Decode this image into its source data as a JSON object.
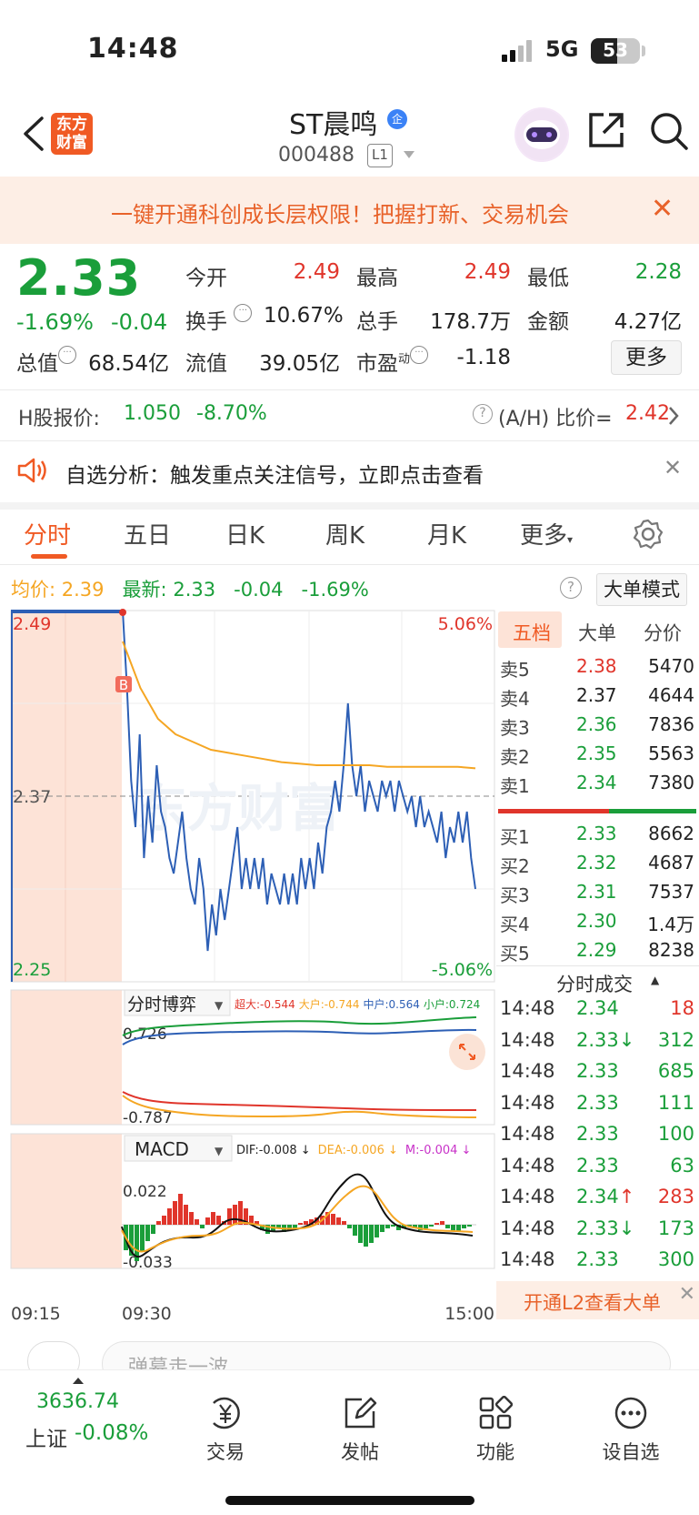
{
  "status": {
    "time": "14:48",
    "network": "5G",
    "battery": "53",
    "battery_level": 0.53
  },
  "nav": {
    "logo": "东方\n财富",
    "logo_line1": "东方",
    "logo_line2": "财富",
    "stock_name": "ST晨鸣",
    "ent_badge": "企",
    "stock_code": "000488",
    "level": "L1"
  },
  "banner": {
    "text": "一键开通科创成长层权限！把握打新、交易机会"
  },
  "quote": {
    "price": "2.33",
    "change_pct": "-1.69%",
    "change_abs": "-0.04",
    "open_label": "今开",
    "open": "2.49",
    "high_label": "最高",
    "high": "2.49",
    "low_label": "最低",
    "low": "2.28",
    "turnover_label": "换手",
    "turnover": "10.67%",
    "volume_label": "总手",
    "volume": "178.7万",
    "amount_label": "金额",
    "amount": "4.27亿",
    "mktcap_label": "总值",
    "mktcap": "68.54亿",
    "float_label": "流值",
    "float": "39.05亿",
    "pe_label": "市盈",
    "pe_sup": "动",
    "pe": "-1.18",
    "more": "更多"
  },
  "hshare": {
    "label": "H股报价:",
    "price": "1.050",
    "change": "-8.70%",
    "ratio_label": "(A/H) 比价=",
    "ratio": "2.42"
  },
  "alert": {
    "text": "自选分析：触发重点关注信号，立即点击查看"
  },
  "tabs": [
    "分时",
    "五日",
    "日K",
    "周K",
    "月K",
    "更多"
  ],
  "legend": {
    "avg_label": "均价:",
    "avg": "2.39",
    "latest_label": "最新:",
    "latest": "2.33",
    "latest_chg": "-0.04",
    "latest_pct": "-1.69%",
    "big_mode": "大单模式"
  },
  "chart_data": {
    "type": "line",
    "y_max_label": "2.49",
    "y_mid_label": "2.37",
    "y_min_label": "2.25",
    "pct_max_label": "5.06%",
    "pct_min_label": "-5.06%",
    "time_labels": [
      "09:15",
      "09:30",
      "15:00"
    ],
    "ylim": [
      2.25,
      2.49
    ],
    "prev_close": 2.37,
    "buy_marker": "B",
    "watermark": "东方财富",
    "series": [
      {
        "name": "最新",
        "color": "#2d5fb5",
        "values": [
          2.49,
          2.44,
          2.38,
          2.35,
          2.41,
          2.33,
          2.37,
          2.34,
          2.39,
          2.36,
          2.35,
          2.33,
          2.32,
          2.34,
          2.36,
          2.33,
          2.31,
          2.3,
          2.33,
          2.31,
          2.27,
          2.3,
          2.28,
          2.31,
          2.29,
          2.31,
          2.33,
          2.35,
          2.31,
          2.33,
          2.31,
          2.33,
          2.31,
          2.33,
          2.3,
          2.32,
          2.31,
          2.3,
          2.32,
          2.3,
          2.32,
          2.3,
          2.33,
          2.31,
          2.33,
          2.31,
          2.34,
          2.32,
          2.35,
          2.36,
          2.38,
          2.36,
          2.39,
          2.43,
          2.39,
          2.37,
          2.39,
          2.36,
          2.38,
          2.37,
          2.36,
          2.38,
          2.37,
          2.38,
          2.36,
          2.38,
          2.37,
          2.36,
          2.37,
          2.35,
          2.37,
          2.35,
          2.36,
          2.35,
          2.34,
          2.36,
          2.33,
          2.35,
          2.34,
          2.36,
          2.34,
          2.36,
          2.33,
          2.31
        ]
      },
      {
        "name": "均价",
        "color": "#f5a623",
        "values": [
          2.47,
          2.44,
          2.42,
          2.41,
          2.405,
          2.4,
          2.398,
          2.396,
          2.394,
          2.392,
          2.391,
          2.39,
          2.39,
          2.39,
          2.39,
          2.389,
          2.389,
          2.389,
          2.389,
          2.389,
          2.388
        ]
      }
    ],
    "game_panel": {
      "title": "分时博弈",
      "super_label": "超大:",
      "super": "-0.544",
      "big_label": "大户:",
      "big": "-0.744",
      "mid_label": "中户:",
      "mid": "0.564",
      "small_label": "小户:",
      "small": "0.724",
      "top_label": "0.726",
      "bottom_label": "-0.787"
    },
    "macd_panel": {
      "title": "MACD",
      "dif_label": "DIF:",
      "dif": "-0.008",
      "dea_label": "DEA:",
      "dea": "-0.006",
      "m_label": "M:",
      "m": "-0.004",
      "top_label": "0.022",
      "bottom_label": "-0.033"
    }
  },
  "orderbook": {
    "tabs": [
      "五档",
      "大单",
      "分价"
    ],
    "asks": [
      {
        "label": "卖5",
        "price": "2.38",
        "vol": "5470",
        "color": "red"
      },
      {
        "label": "卖4",
        "price": "2.37",
        "vol": "4644",
        "color": "black"
      },
      {
        "label": "卖3",
        "price": "2.36",
        "vol": "7836",
        "color": "green"
      },
      {
        "label": "卖2",
        "price": "2.35",
        "vol": "5563",
        "color": "green"
      },
      {
        "label": "卖1",
        "price": "2.34",
        "vol": "7380",
        "color": "green"
      }
    ],
    "bids": [
      {
        "label": "买1",
        "price": "2.33",
        "vol": "8662",
        "color": "green"
      },
      {
        "label": "买2",
        "price": "2.32",
        "vol": "4687",
        "color": "green"
      },
      {
        "label": "买3",
        "price": "2.31",
        "vol": "7537",
        "color": "green"
      },
      {
        "label": "买4",
        "price": "2.30",
        "vol": "1.4万",
        "color": "green"
      },
      {
        "label": "买5",
        "price": "2.29",
        "vol": "8238",
        "color": "green"
      }
    ],
    "ask_ratio": 0.56
  },
  "trades": {
    "title": "分时成交",
    "rows": [
      {
        "time": "14:48",
        "price": "2.34",
        "arrow": "",
        "vol": "18",
        "vcolor": "red"
      },
      {
        "time": "14:48",
        "price": "2.33",
        "arrow": "↓",
        "vol": "312",
        "vcolor": "green"
      },
      {
        "time": "14:48",
        "price": "2.33",
        "arrow": "",
        "vol": "685",
        "vcolor": "green"
      },
      {
        "time": "14:48",
        "price": "2.33",
        "arrow": "",
        "vol": "111",
        "vcolor": "green"
      },
      {
        "time": "14:48",
        "price": "2.33",
        "arrow": "",
        "vol": "100",
        "vcolor": "green"
      },
      {
        "time": "14:48",
        "price": "2.33",
        "arrow": "",
        "vol": "63",
        "vcolor": "green"
      },
      {
        "time": "14:48",
        "price": "2.34",
        "arrow": "↑",
        "vol": "283",
        "vcolor": "red"
      },
      {
        "time": "14:48",
        "price": "2.33",
        "arrow": "↓",
        "vol": "173",
        "vcolor": "green"
      },
      {
        "time": "14:48",
        "price": "2.33",
        "arrow": "",
        "vol": "300",
        "vcolor": "green"
      }
    ],
    "l2_text": "开通L2查看大单"
  },
  "danmu": {
    "placeholder": "弹幕走一波"
  },
  "bottombar": {
    "index_value": "3636.74",
    "index_name": "上证",
    "index_change": "-0.08%",
    "items": [
      "交易",
      "发帖",
      "功能",
      "设自选"
    ]
  }
}
